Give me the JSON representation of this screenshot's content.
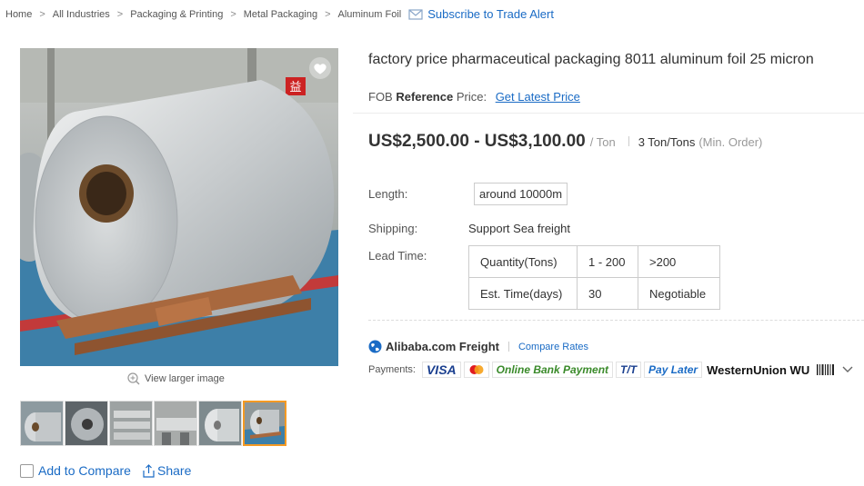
{
  "breadcrumb": [
    "Home",
    "All Industries",
    "Packaging & Printing",
    "Metal Packaging",
    "Aluminum Foil"
  ],
  "trade_alert": {
    "label": "Subscribe to Trade Alert"
  },
  "product": {
    "title": "factory price pharmaceutical packaging 8011 aluminum foil 25 micron",
    "fob_prefix": "FOB ",
    "fob_bold": "Reference",
    "fob_suffix": " Price:",
    "get_latest_price": "Get Latest Price",
    "price": "US$2,500.00 - US$3,100.00",
    "price_unit": "/ Ton",
    "moq": "3 Ton/Tons",
    "moq_note": "(Min. Order)"
  },
  "attributes": {
    "length_label": "Length:",
    "length_value": "around 10000m",
    "shipping_label": "Shipping:",
    "shipping_value": "Support Sea freight",
    "lead_time_label": "Lead Time:"
  },
  "lead_time_table": {
    "rows": [
      [
        "Quantity(Tons)",
        "1 - 200",
        ">200"
      ],
      [
        "Est. Time(days)",
        "30",
        "Negotiable"
      ]
    ]
  },
  "freight": {
    "brand": "Alibaba.com Freight",
    "compare_rates": "Compare Rates"
  },
  "payments": {
    "label": "Payments:",
    "methods": [
      "VISA",
      "Online Bank Payment",
      "T/T",
      "Pay Later",
      "WesternUnion WU"
    ]
  },
  "gallery": {
    "view_larger": "View larger image",
    "thumb_count": 6,
    "active_thumb": 6
  },
  "actions": {
    "add_to_compare": "Add to Compare",
    "share": "Share"
  },
  "colors": {
    "link": "#1a6bc5",
    "accent": "#f59a23",
    "text": "#333333"
  }
}
